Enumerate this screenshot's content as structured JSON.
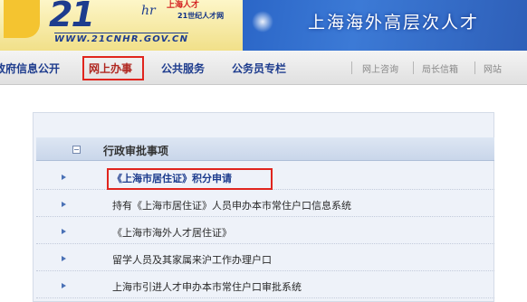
{
  "banner": {
    "logo_number": "21",
    "logo_hr": "hr",
    "logo_red_text": "上海人才",
    "logo_slogan": "21世纪人才网",
    "logo_url": "WWW.21CNHR.GOV.CN",
    "title": "上海海外高层次人才"
  },
  "nav": {
    "items": [
      {
        "label": "政府信息公开"
      },
      {
        "label": "网上办事"
      },
      {
        "label": "公共服务"
      },
      {
        "label": "公务员专栏"
      }
    ],
    "right_items": [
      {
        "label": "网上咨询"
      },
      {
        "label": "局长信箱"
      },
      {
        "label": "网站"
      }
    ],
    "active_index": 1
  },
  "panel": {
    "header_title": "行政审批事项",
    "rows": [
      {
        "label": "《上海市居住证》积分申请"
      },
      {
        "label": "持有《上海市居住证》人员申办本市常住户口信息系统"
      },
      {
        "label": "《上海市海外人才居住证》"
      },
      {
        "label": "留学人员及其家属来沪工作办理户口"
      },
      {
        "label": "上海市引进人才申办本市常住户口审批系统"
      }
    ]
  },
  "colors": {
    "highlight_border": "#e0251e",
    "banner_blue": "#2b66c7",
    "link_blue": "#1d3c8e"
  }
}
